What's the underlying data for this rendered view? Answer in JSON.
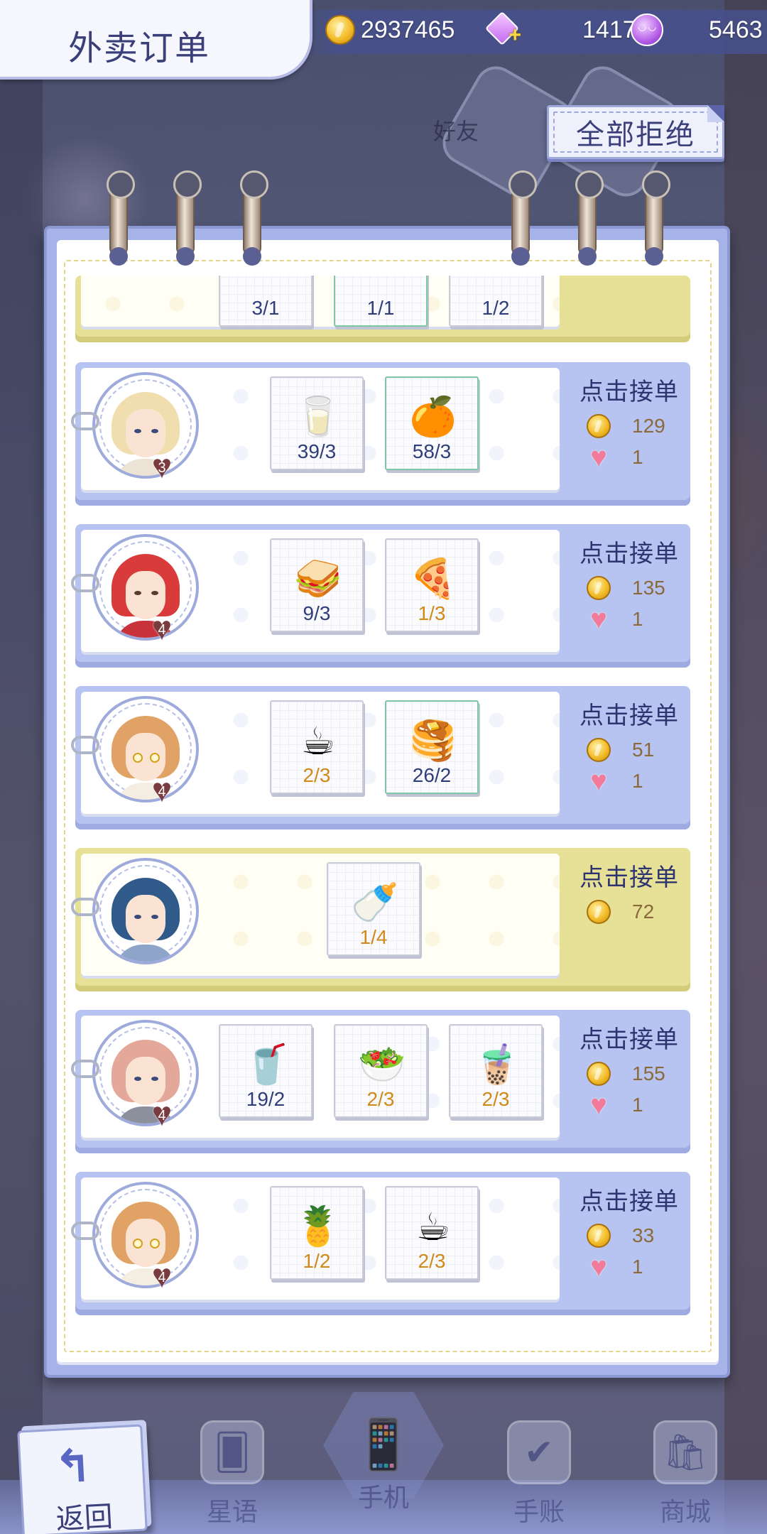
{
  "header": {
    "title": "外卖订单",
    "currencies": [
      {
        "icon": "gold-coin-icon",
        "value": "2937465"
      },
      {
        "icon": "crystal-plus-icon",
        "value": "1417"
      },
      {
        "icon": "purple-moon-gem-icon",
        "value": "5463"
      }
    ]
  },
  "background": {
    "friends_label": "好友"
  },
  "reject_all_label": "全部拒绝",
  "partial_order": {
    "counts": [
      "3/1",
      "1/1",
      "1/2"
    ]
  },
  "orders": [
    {
      "theme": "blue",
      "affinity": "3",
      "items": [
        {
          "food": "milk-glass-icon",
          "count": "39/3"
        },
        {
          "food": "orange-dessert-icon",
          "count": "58/3"
        }
      ],
      "accept_label": "点击接单",
      "coins": "129",
      "hearts": "1"
    },
    {
      "theme": "blue",
      "affinity": "4",
      "items": [
        {
          "food": "sandwich-icon",
          "count": "9/3"
        },
        {
          "food": "pizza-slice-icon",
          "count": "1/3"
        }
      ],
      "accept_label": "点击接单",
      "coins": "135",
      "hearts": "1"
    },
    {
      "theme": "blue",
      "affinity": "4",
      "items": [
        {
          "food": "coffee-cup-icon",
          "count": "2/3"
        },
        {
          "food": "pancake-icon",
          "count": "26/2"
        }
      ],
      "accept_label": "点击接单",
      "coins": "51",
      "hearts": "1"
    },
    {
      "theme": "yellow",
      "affinity": "",
      "items": [
        {
          "food": "milk-cup-icon",
          "count": "1/4"
        }
      ],
      "accept_label": "点击接单",
      "coins": "72",
      "hearts": ""
    },
    {
      "theme": "blue",
      "affinity": "4",
      "items": [
        {
          "food": "water-glass-icon",
          "count": "19/2"
        },
        {
          "food": "salad-icon",
          "count": "2/3"
        },
        {
          "food": "iced-drink-icon",
          "count": "2/3"
        }
      ],
      "accept_label": "点击接单",
      "coins": "155",
      "hearts": "1"
    },
    {
      "theme": "blue",
      "affinity": "4",
      "items": [
        {
          "food": "fruit-plate-icon",
          "count": "1/2"
        },
        {
          "food": "coffee-cup-icon",
          "count": "2/3"
        }
      ],
      "accept_label": "点击接单",
      "coins": "33",
      "hearts": "1"
    }
  ],
  "bottom_nav": {
    "back_label": "返回",
    "items": [
      {
        "label": "星语",
        "icon": "card-icon"
      },
      {
        "label": "手机",
        "icon": "phone-icon"
      },
      {
        "label": "手账",
        "icon": "calendar-check-icon"
      },
      {
        "label": "商城",
        "icon": "shop-bag-icon"
      }
    ]
  },
  "colors": {
    "accent": "#3a3f7a",
    "card_blue": "#b7c3f0",
    "card_yellow": "#e6e196",
    "short_count": "#d08a1a"
  }
}
